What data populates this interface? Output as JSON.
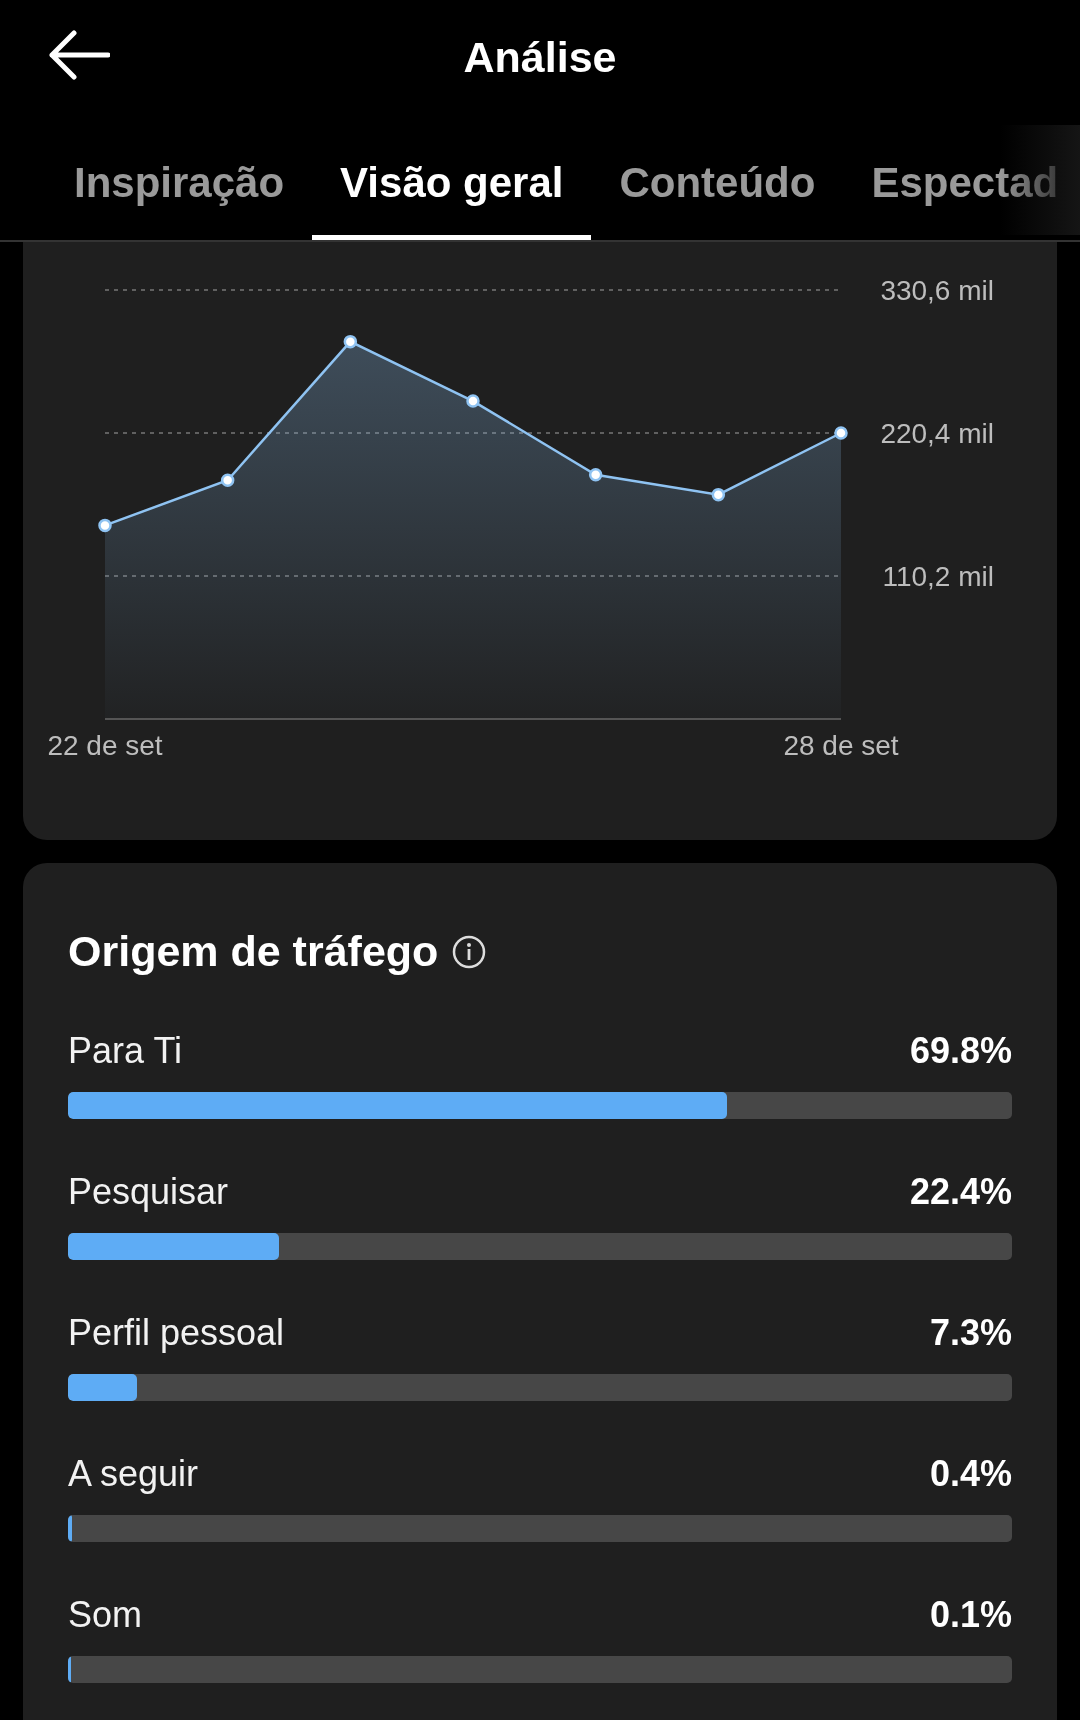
{
  "header": {
    "title": "Análise"
  },
  "tabs": [
    {
      "label": "Inspiração",
      "selected": false
    },
    {
      "label": "Visão geral",
      "selected": true
    },
    {
      "label": "Conteúdo",
      "selected": false
    },
    {
      "label": "Espectad",
      "selected": false
    }
  ],
  "views_chart": {
    "chart_data": {
      "type": "area",
      "x": [
        22,
        23,
        24,
        25,
        26,
        27,
        28
      ],
      "xlim": [
        22,
        28
      ],
      "series": [
        {
          "color": "#8fc3f2",
          "values": [
            149.2,
            184.0,
            290.8,
            245.0,
            188.2,
            172.9,
            220.4
          ]
        }
      ],
      "ylim": [
        0,
        330.6
      ],
      "yticks": [
        {
          "value": 110.2,
          "label": "110,2 mil"
        },
        {
          "value": 220.4,
          "label": "220,4 mil"
        },
        {
          "value": 330.6,
          "label": "330,6 mil"
        }
      ],
      "xticks": [
        {
          "value": 22,
          "label": "22 de set"
        },
        {
          "value": 28,
          "label": "28 de set"
        }
      ]
    }
  },
  "traffic": {
    "title": "Origem de tráfego",
    "sources": [
      {
        "name": "Para Ti",
        "value": "69.8%",
        "level": 0.698
      },
      {
        "name": "Pesquisar",
        "value": "22.4%",
        "level": 0.224
      },
      {
        "name": "Perfil pessoal",
        "value": "7.3%",
        "level": 0.073
      },
      {
        "name": "A seguir",
        "value": "0.4%",
        "level": 0.004
      },
      {
        "name": "Som",
        "value": "0.1%",
        "level": 0.001
      }
    ]
  }
}
